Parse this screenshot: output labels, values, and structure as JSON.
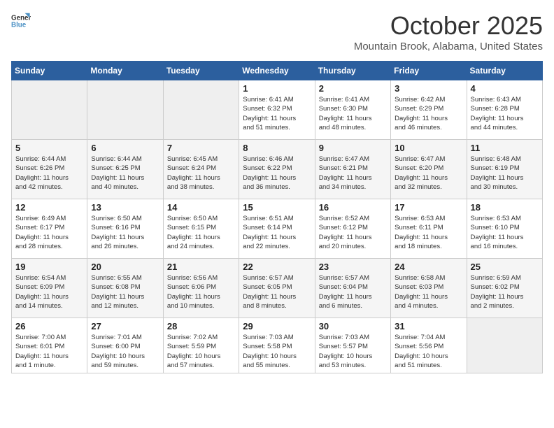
{
  "logo": {
    "general": "General",
    "blue": "Blue"
  },
  "header": {
    "month": "October 2025",
    "location": "Mountain Brook, Alabama, United States"
  },
  "weekdays": [
    "Sunday",
    "Monday",
    "Tuesday",
    "Wednesday",
    "Thursday",
    "Friday",
    "Saturday"
  ],
  "weeks": [
    [
      {
        "day": "",
        "info": ""
      },
      {
        "day": "",
        "info": ""
      },
      {
        "day": "",
        "info": ""
      },
      {
        "day": "1",
        "info": "Sunrise: 6:41 AM\nSunset: 6:32 PM\nDaylight: 11 hours\nand 51 minutes."
      },
      {
        "day": "2",
        "info": "Sunrise: 6:41 AM\nSunset: 6:30 PM\nDaylight: 11 hours\nand 48 minutes."
      },
      {
        "day": "3",
        "info": "Sunrise: 6:42 AM\nSunset: 6:29 PM\nDaylight: 11 hours\nand 46 minutes."
      },
      {
        "day": "4",
        "info": "Sunrise: 6:43 AM\nSunset: 6:28 PM\nDaylight: 11 hours\nand 44 minutes."
      }
    ],
    [
      {
        "day": "5",
        "info": "Sunrise: 6:44 AM\nSunset: 6:26 PM\nDaylight: 11 hours\nand 42 minutes."
      },
      {
        "day": "6",
        "info": "Sunrise: 6:44 AM\nSunset: 6:25 PM\nDaylight: 11 hours\nand 40 minutes."
      },
      {
        "day": "7",
        "info": "Sunrise: 6:45 AM\nSunset: 6:24 PM\nDaylight: 11 hours\nand 38 minutes."
      },
      {
        "day": "8",
        "info": "Sunrise: 6:46 AM\nSunset: 6:22 PM\nDaylight: 11 hours\nand 36 minutes."
      },
      {
        "day": "9",
        "info": "Sunrise: 6:47 AM\nSunset: 6:21 PM\nDaylight: 11 hours\nand 34 minutes."
      },
      {
        "day": "10",
        "info": "Sunrise: 6:47 AM\nSunset: 6:20 PM\nDaylight: 11 hours\nand 32 minutes."
      },
      {
        "day": "11",
        "info": "Sunrise: 6:48 AM\nSunset: 6:19 PM\nDaylight: 11 hours\nand 30 minutes."
      }
    ],
    [
      {
        "day": "12",
        "info": "Sunrise: 6:49 AM\nSunset: 6:17 PM\nDaylight: 11 hours\nand 28 minutes."
      },
      {
        "day": "13",
        "info": "Sunrise: 6:50 AM\nSunset: 6:16 PM\nDaylight: 11 hours\nand 26 minutes."
      },
      {
        "day": "14",
        "info": "Sunrise: 6:50 AM\nSunset: 6:15 PM\nDaylight: 11 hours\nand 24 minutes."
      },
      {
        "day": "15",
        "info": "Sunrise: 6:51 AM\nSunset: 6:14 PM\nDaylight: 11 hours\nand 22 minutes."
      },
      {
        "day": "16",
        "info": "Sunrise: 6:52 AM\nSunset: 6:12 PM\nDaylight: 11 hours\nand 20 minutes."
      },
      {
        "day": "17",
        "info": "Sunrise: 6:53 AM\nSunset: 6:11 PM\nDaylight: 11 hours\nand 18 minutes."
      },
      {
        "day": "18",
        "info": "Sunrise: 6:53 AM\nSunset: 6:10 PM\nDaylight: 11 hours\nand 16 minutes."
      }
    ],
    [
      {
        "day": "19",
        "info": "Sunrise: 6:54 AM\nSunset: 6:09 PM\nDaylight: 11 hours\nand 14 minutes."
      },
      {
        "day": "20",
        "info": "Sunrise: 6:55 AM\nSunset: 6:08 PM\nDaylight: 11 hours\nand 12 minutes."
      },
      {
        "day": "21",
        "info": "Sunrise: 6:56 AM\nSunset: 6:06 PM\nDaylight: 11 hours\nand 10 minutes."
      },
      {
        "day": "22",
        "info": "Sunrise: 6:57 AM\nSunset: 6:05 PM\nDaylight: 11 hours\nand 8 minutes."
      },
      {
        "day": "23",
        "info": "Sunrise: 6:57 AM\nSunset: 6:04 PM\nDaylight: 11 hours\nand 6 minutes."
      },
      {
        "day": "24",
        "info": "Sunrise: 6:58 AM\nSunset: 6:03 PM\nDaylight: 11 hours\nand 4 minutes."
      },
      {
        "day": "25",
        "info": "Sunrise: 6:59 AM\nSunset: 6:02 PM\nDaylight: 11 hours\nand 2 minutes."
      }
    ],
    [
      {
        "day": "26",
        "info": "Sunrise: 7:00 AM\nSunset: 6:01 PM\nDaylight: 11 hours\nand 1 minute."
      },
      {
        "day": "27",
        "info": "Sunrise: 7:01 AM\nSunset: 6:00 PM\nDaylight: 10 hours\nand 59 minutes."
      },
      {
        "day": "28",
        "info": "Sunrise: 7:02 AM\nSunset: 5:59 PM\nDaylight: 10 hours\nand 57 minutes."
      },
      {
        "day": "29",
        "info": "Sunrise: 7:03 AM\nSunset: 5:58 PM\nDaylight: 10 hours\nand 55 minutes."
      },
      {
        "day": "30",
        "info": "Sunrise: 7:03 AM\nSunset: 5:57 PM\nDaylight: 10 hours\nand 53 minutes."
      },
      {
        "day": "31",
        "info": "Sunrise: 7:04 AM\nSunset: 5:56 PM\nDaylight: 10 hours\nand 51 minutes."
      },
      {
        "day": "",
        "info": ""
      }
    ]
  ]
}
